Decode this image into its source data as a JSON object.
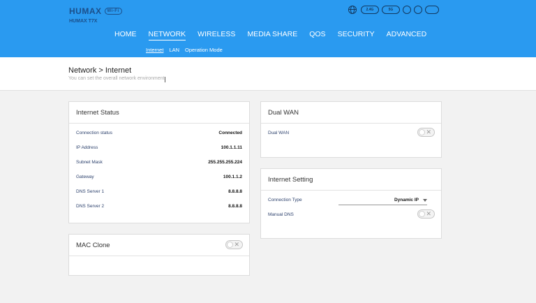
{
  "brand": {
    "logo": "HUMAX",
    "badge": "Wi-Fi",
    "model": "HUMAX T7X"
  },
  "topbar": {
    "icons": [
      "globe-icon",
      "2.4G-icon",
      "5G-icon",
      "5G-2-icon",
      "info-icon",
      "power-icon"
    ],
    "pills": [
      "2.4G",
      "5G",
      "",
      "",
      ""
    ]
  },
  "nav": {
    "items": [
      "HOME",
      "NETWORK",
      "WIRELESS",
      "MEDIA SHARE",
      "QOS",
      "SECURITY",
      "ADVANCED"
    ],
    "active": "NETWORK"
  },
  "subnav": {
    "items": [
      "Internet",
      "LAN",
      "Operation Mode"
    ],
    "active": "Internet"
  },
  "page": {
    "title": "Network > Internet",
    "subtitle": "You can set the overall network environment."
  },
  "internet_status": {
    "title": "Internet Status",
    "rows": [
      {
        "label": "Connection status",
        "value": "Connected"
      },
      {
        "label": "IP Address",
        "value": "100.1.1.11"
      },
      {
        "label": "Subnet Mask",
        "value": "255.255.255.224"
      },
      {
        "label": "Gateway",
        "value": "100.1.1.2"
      },
      {
        "label": "DNS Server 1",
        "value": "8.8.8.8"
      },
      {
        "label": "DNS Server 2",
        "value": "8.8.8.8"
      }
    ]
  },
  "mac_clone": {
    "title": "MAC Clone",
    "enabled": false
  },
  "dual_wan": {
    "title": "Dual WAN",
    "label": "Dual WAN",
    "enabled": false
  },
  "internet_setting": {
    "title": "Internet Setting",
    "connection_type_label": "Connection Type",
    "connection_type_value": "Dynamic IP",
    "manual_dns_label": "Manual DNS",
    "manual_dns_enabled": false
  },
  "toggle_off_symbol": "✕"
}
